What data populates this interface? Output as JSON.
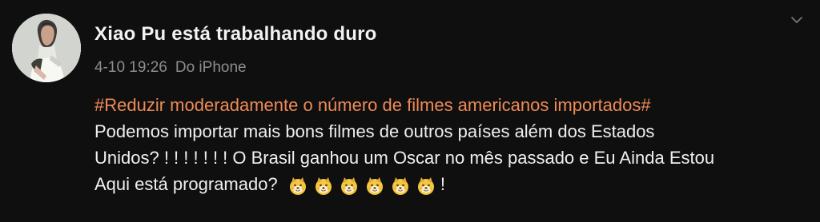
{
  "post": {
    "author": {
      "name": "Xiao Pu está trabalhando duro",
      "avatar_icon": "profile-avatar"
    },
    "meta": {
      "timestamp": "4-10 19:26",
      "source": "Do iPhone"
    },
    "menu_icon": "chevron-down-icon",
    "content": {
      "hashtag": "#Reduzir moderadamente o número de filmes americanos importados#",
      "line1": " Podemos importar mais bons filmes de outros países além dos Estados",
      "line2": "Unidos? ! ! ! ! ! ! ! O Brasil ganhou um Oscar no mês passado e Eu Ainda Estou",
      "line3_text": "Aqui está programado? ",
      "line3_suffix": "!",
      "emoji_name": "doge-emoji",
      "emoji_count": 6
    },
    "colors": {
      "background": "#0f0f0f",
      "hashtag": "#ef8a56",
      "text": "#efefef",
      "meta": "#8d8d8d"
    }
  }
}
